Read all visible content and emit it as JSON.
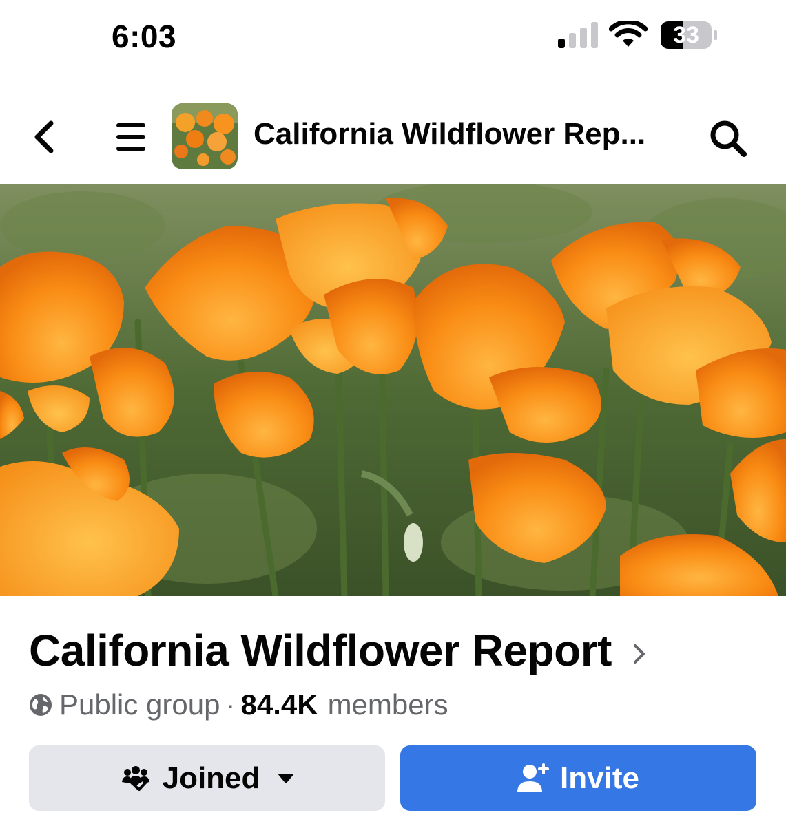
{
  "status_bar": {
    "time": "6:03",
    "battery_level": "33",
    "icons": [
      "cellular-signal-icon",
      "wifi-icon",
      "battery-icon"
    ]
  },
  "nav": {
    "title": "California Wildflower Rep...",
    "icons": [
      "back-chevron-icon",
      "hamburger-menu-icon",
      "search-icon"
    ]
  },
  "group": {
    "name": "California Wildflower Report",
    "privacy": "Public group",
    "separator": "·",
    "member_count": "84.4K",
    "member_label": "members"
  },
  "actions": {
    "joined_label": "Joined",
    "invite_label": "Invite"
  },
  "colors": {
    "primary_blue": "#3578e5",
    "secondary_gray": "#e4e6eb",
    "text_primary": "#050505",
    "text_secondary": "#65676b",
    "poppy_orange": "#f7871c"
  }
}
